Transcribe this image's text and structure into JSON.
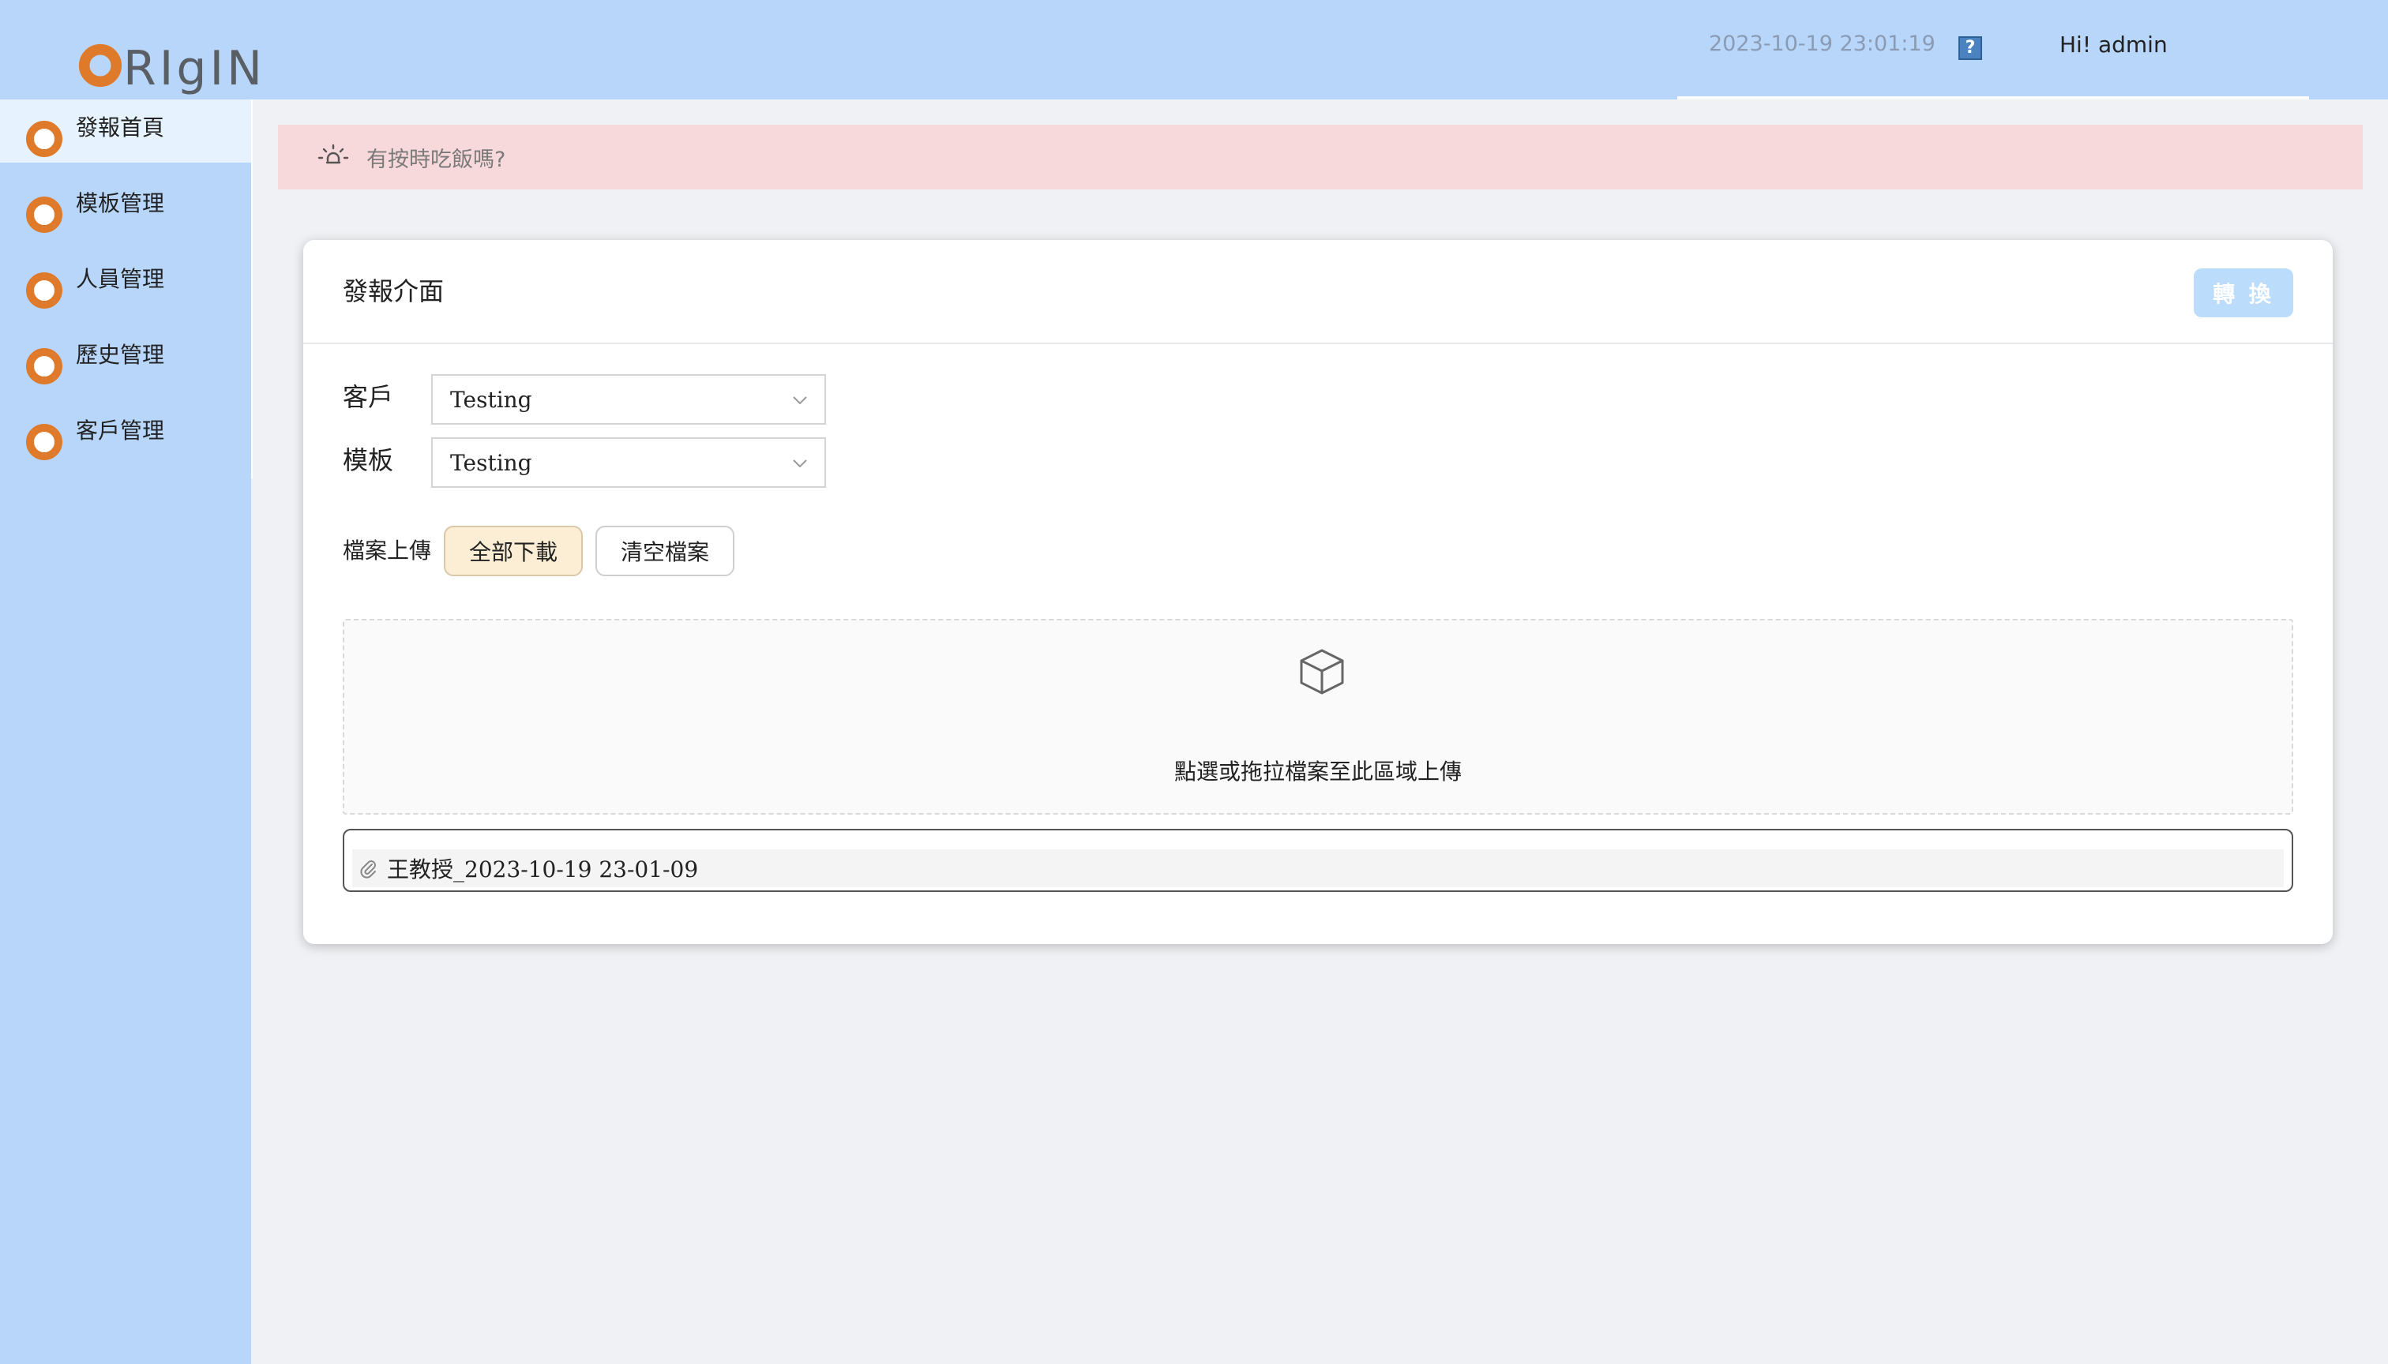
{
  "header": {
    "logo_text": "RIgIN",
    "datetime": "2023-10-19 23:01:19",
    "help_label": "?",
    "greeting": "Hi! admin"
  },
  "sidebar": {
    "items": [
      {
        "label": "發報首頁",
        "active": true
      },
      {
        "label": "模板管理",
        "active": false
      },
      {
        "label": "人員管理",
        "active": false
      },
      {
        "label": "歷史管理",
        "active": false
      },
      {
        "label": "客戶管理",
        "active": false
      }
    ]
  },
  "notice": {
    "text": "有按時吃飯嗎?"
  },
  "card": {
    "title": "發報介面",
    "convert_label": "轉 換",
    "customer_label": "客戶",
    "customer_value": "Testing",
    "template_label": "模板",
    "template_value": "Testing",
    "upload_label": "檔案上傳",
    "download_all_label": "全部下載",
    "clear_files_label": "清空檔案",
    "dropzone_text": "點選或拖拉檔案至此區域上傳",
    "files": [
      "王教授_2023-10-19 23-01-09"
    ]
  },
  "colors": {
    "header_bg": "#b7d6fa",
    "accent_orange": "#e07a2b",
    "notice_bg": "#f8d9db",
    "convert_btn_bg": "#bcdcfb"
  },
  "icons": {
    "logo": "orange-ring-icon",
    "help": "question-mark-icon",
    "nav": "orange-ring-icon",
    "notice": "lightbulb-icon",
    "select": "chevron-down-icon",
    "dropzone": "box-icon",
    "file": "paperclip-icon"
  }
}
